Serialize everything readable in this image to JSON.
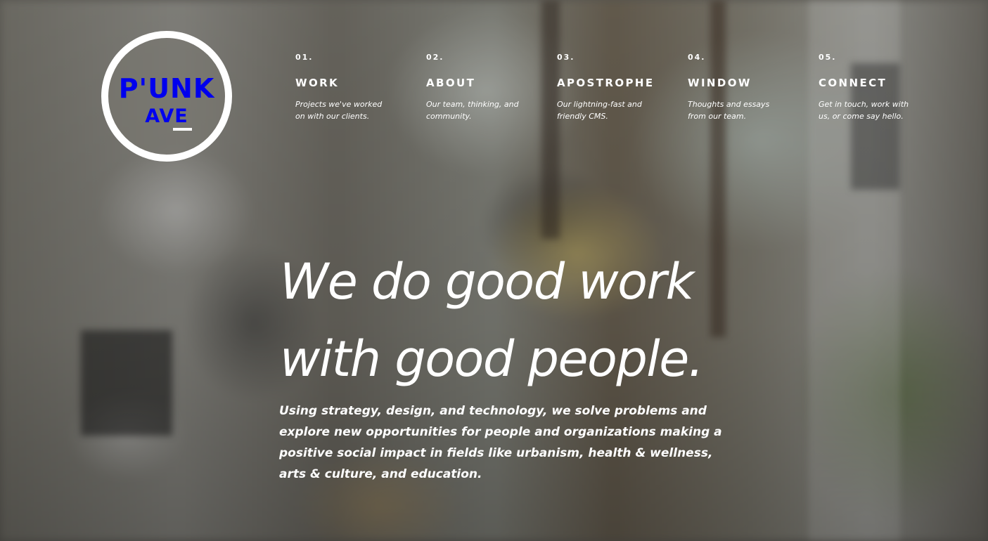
{
  "brand": {
    "logo_line1": "P'UNK",
    "logo_line2": "AVE"
  },
  "nav": {
    "items": [
      {
        "number": "01.",
        "title": "WORK",
        "description": "Projects we've worked on with our clients."
      },
      {
        "number": "02.",
        "title": "ABOUT",
        "description": "Our team, thinking, and community."
      },
      {
        "number": "03.",
        "title": "APOSTROPHE",
        "description": "Our lightning-fast and friendly CMS."
      },
      {
        "number": "04.",
        "title": "WINDOW",
        "description": "Thoughts and essays from our team."
      },
      {
        "number": "05.",
        "title": "CONNECT",
        "description": "Get in touch, work with us, or come say hello."
      }
    ]
  },
  "hero": {
    "headline_line1": "We do good work",
    "headline_line2": "with good people.",
    "tagline": "Using strategy, design, and technology, we solve problems and explore new opportunities for people and organizations making a positive social impact in fields like urbanism, health & wellness, arts & culture, and education."
  }
}
